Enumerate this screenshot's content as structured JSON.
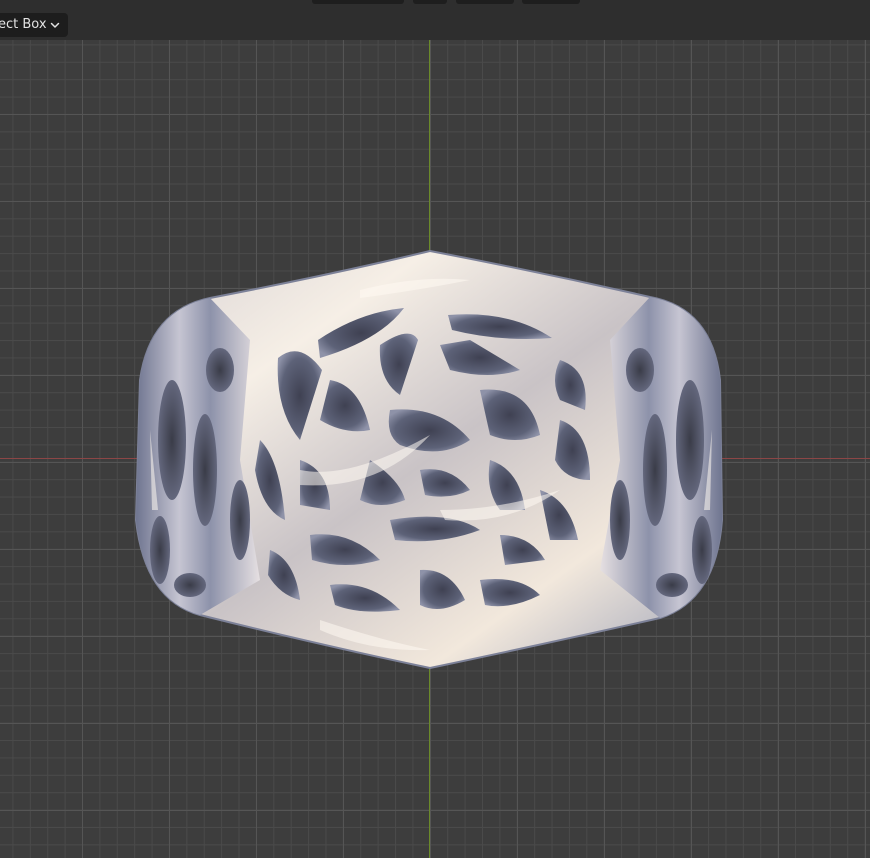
{
  "header": {
    "select_mode_label": "ect Box",
    "select_mode_icon": "chevron-down-icon"
  },
  "viewport": {
    "object": "ring",
    "object_icon": "voronoi-lattice-ring"
  },
  "colors": {
    "header_bg": "#2e2e2e",
    "viewport_bg": "#3d3d3d",
    "grid_line": "#555555",
    "x_axis": "#8c4646",
    "y_axis": "#6b8a2a",
    "metal_light": "#f3ece3",
    "metal_shadow": "#5b6178"
  }
}
